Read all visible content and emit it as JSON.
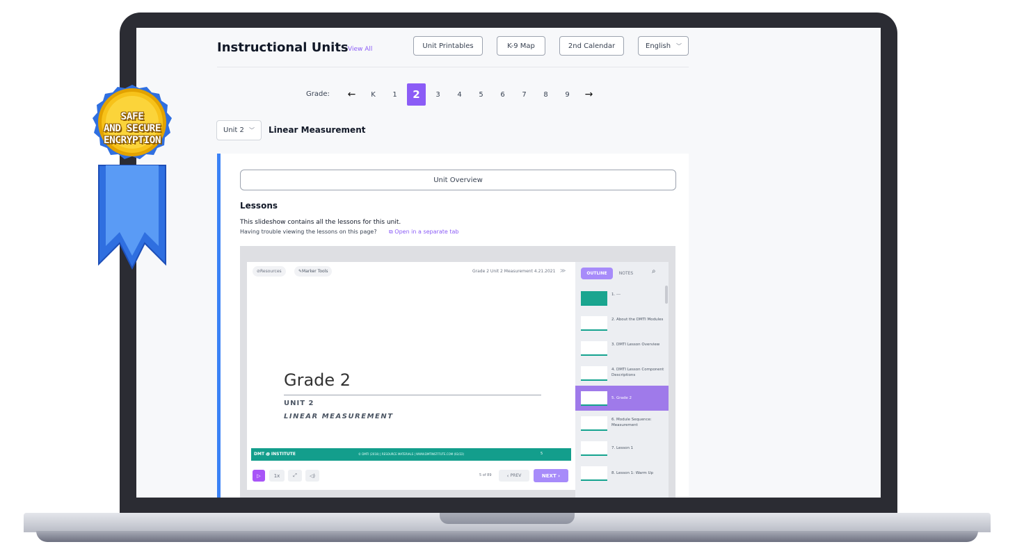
{
  "header": {
    "title": "Instructional Units",
    "view_all": "View All",
    "buttons": [
      "Unit Printables",
      "K-9 Map",
      "2nd Calendar"
    ],
    "language": "English"
  },
  "grades": {
    "label": "Grade:",
    "prev": "←",
    "next": "→",
    "items": [
      "K",
      "1",
      "2",
      "3",
      "4",
      "5",
      "6",
      "7",
      "8",
      "9"
    ],
    "selected": "2"
  },
  "unit": {
    "select_value": "Unit 2",
    "title": "Linear Measurement"
  },
  "card": {
    "overview_button": "Unit Overview",
    "lessons_heading": "Lessons",
    "lessons_desc": "This slideshow contains all the lessons for this unit.",
    "trouble_text": "Having trouble viewing the lessons on this page?",
    "open_link": "Open in a separate tab"
  },
  "viewer": {
    "resources": "Resources",
    "marker_tools": "Marker Tools",
    "deck_title": "Grade 2 Unit 2 Measurement 4.21.2021",
    "slide": {
      "heading": "Grade 2",
      "unit": "UNIT 2",
      "subtitle": "LINEAR MEASUREMENT",
      "footer_logo": "DMT ꩜ INSTITUTE",
      "footer_copy": "© DMTI (2018) | RESOURCE MATERIALS | WWW.DMTINSTITUTE.COM (02/22)",
      "footer_num": "5"
    },
    "controls": {
      "speed": "1x",
      "page": "5 of 89",
      "prev": "PREV",
      "next": "NEXT"
    },
    "outline": {
      "tab_outline": "OUTLINE",
      "tab_notes": "NOTES",
      "items": [
        "1. ---",
        "2. About the DMTI Modules",
        "3. DMTI Lesson Overview",
        "4. DMTI Lesson Component Descriptions",
        "5. Grade 2",
        "6. Module Sequence: Measurement",
        "7. Lesson 1",
        "8. Lesson 1: Warm Up"
      ],
      "selected_index": 4
    }
  },
  "badge": {
    "line1": "SAFE",
    "line2": "AND SECURE",
    "line3": "ENCRYPTION",
    "colors": {
      "gold": "#f5b400",
      "ribbon": "#3b82f6"
    }
  }
}
